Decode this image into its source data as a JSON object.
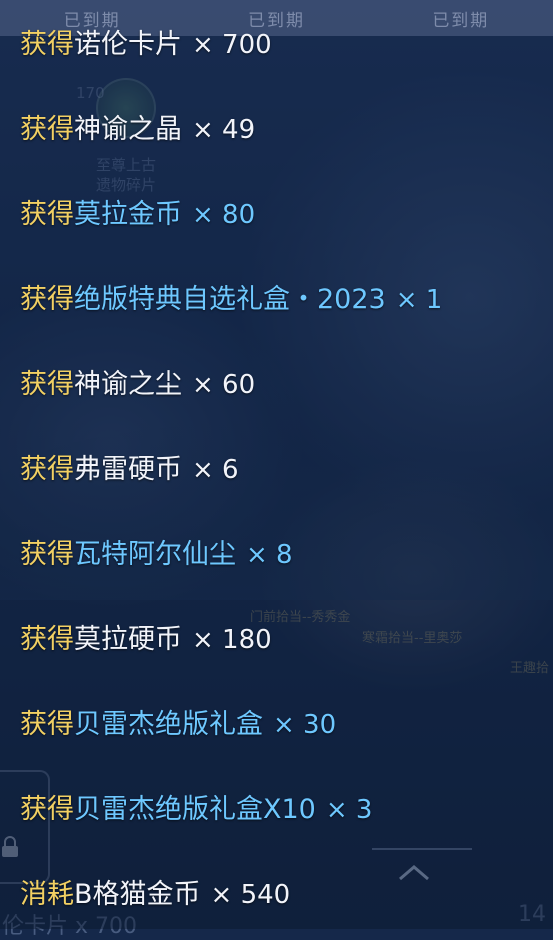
{
  "topbar": {
    "tabs": [
      "已到期",
      "已到期",
      "已到期"
    ]
  },
  "background_text": {
    "level": "170",
    "relic_line1": "至尊上古",
    "relic_line2": "遗物碎片",
    "npc_name_1": "门前拾当--秀秀金",
    "npc_name_2": "寒霜拾当--里奥莎",
    "npc_name_3": "王趣拾",
    "bottom_left": "伦卡片 x 700",
    "bottom_right": "14"
  },
  "colors": {
    "verb": "#f2d063",
    "normal_item": "#f2f4fa",
    "highlight_item": "#6ec8ff"
  },
  "log": [
    {
      "verb": "获得",
      "item": "诺伦卡片",
      "qty": "× 700",
      "highlight": false
    },
    {
      "verb": "获得",
      "item": "神谕之晶",
      "qty": "× 49",
      "highlight": false
    },
    {
      "verb": "获得",
      "item": "莫拉金币",
      "qty": "× 80",
      "highlight": true
    },
    {
      "verb": "获得",
      "item": "绝版特典自选礼盒・2023",
      "qty": "× 1",
      "highlight": true
    },
    {
      "verb": "获得",
      "item": "神谕之尘",
      "qty": "× 60",
      "highlight": false
    },
    {
      "verb": "获得",
      "item": "弗雷硬币",
      "qty": "× 6",
      "highlight": false
    },
    {
      "verb": "获得",
      "item": "瓦特阿尔仙尘",
      "qty": "× 8",
      "highlight": true
    },
    {
      "verb": "获得",
      "item": "莫拉硬币",
      "qty": "× 180",
      "highlight": false
    },
    {
      "verb": "获得",
      "item": "贝雷杰绝版礼盒",
      "qty": "× 30",
      "highlight": true
    },
    {
      "verb": "获得",
      "item": "贝雷杰绝版礼盒X10",
      "qty": "× 3",
      "highlight": true
    },
    {
      "verb": "消耗",
      "item": "B格猫金币",
      "qty": "× 540",
      "highlight": false
    }
  ],
  "icons": [
    "lock-icon",
    "chevron-up-icon"
  ]
}
